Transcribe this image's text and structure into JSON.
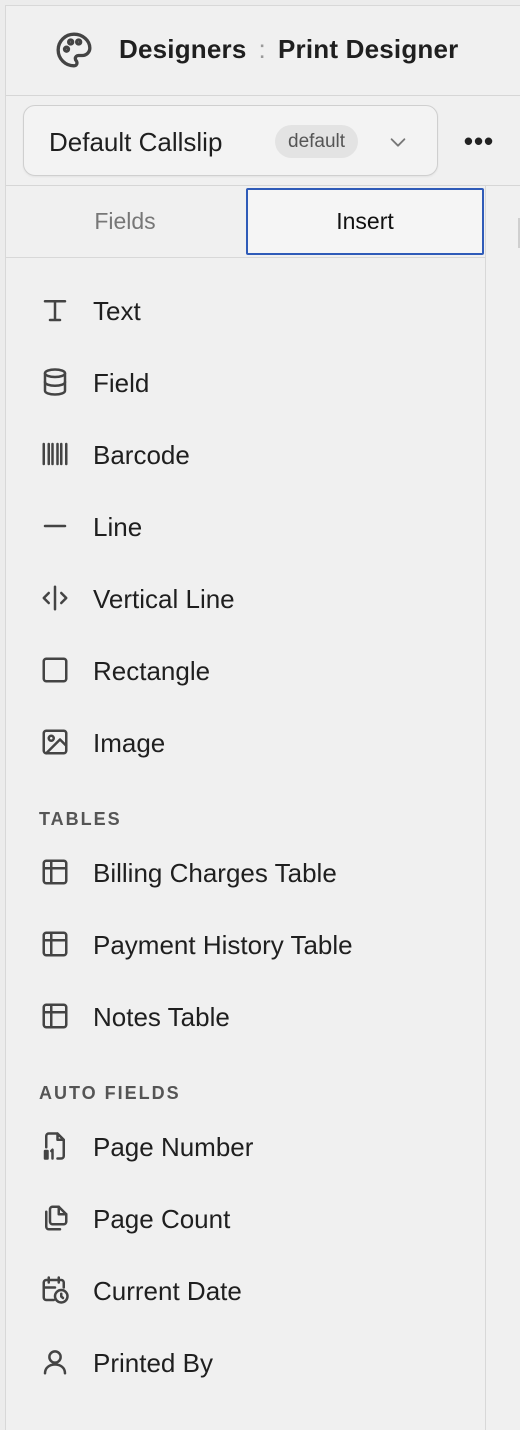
{
  "header": {
    "app": "Designers",
    "separator": ":",
    "page": "Print Designer"
  },
  "toolbar": {
    "layout_name": "Default Callslip",
    "layout_badge": "default",
    "more_label": "•••"
  },
  "tabs": [
    {
      "label": "Fields"
    },
    {
      "label": "Insert"
    }
  ],
  "basic_items": [
    {
      "label": "Text",
      "icon": "text-icon"
    },
    {
      "label": "Field",
      "icon": "database-icon"
    },
    {
      "label": "Barcode",
      "icon": "barcode-icon"
    },
    {
      "label": "Line",
      "icon": "line-icon"
    },
    {
      "label": "Vertical Line",
      "icon": "vertical-line-icon"
    },
    {
      "label": "Rectangle",
      "icon": "rectangle-icon"
    },
    {
      "label": "Image",
      "icon": "image-icon"
    }
  ],
  "tables_section": {
    "title": "TABLES",
    "items": [
      {
        "label": "Billing Charges Table",
        "icon": "table-icon"
      },
      {
        "label": "Payment History Table",
        "icon": "table-icon"
      },
      {
        "label": "Notes Table",
        "icon": "table-icon"
      }
    ]
  },
  "auto_fields_section": {
    "title": "AUTO FIELDS",
    "items": [
      {
        "label": "Page Number",
        "icon": "page-number-icon"
      },
      {
        "label": "Page Count",
        "icon": "page-count-icon"
      },
      {
        "label": "Current Date",
        "icon": "calendar-clock-icon"
      },
      {
        "label": "Printed By",
        "icon": "user-icon"
      }
    ]
  }
}
